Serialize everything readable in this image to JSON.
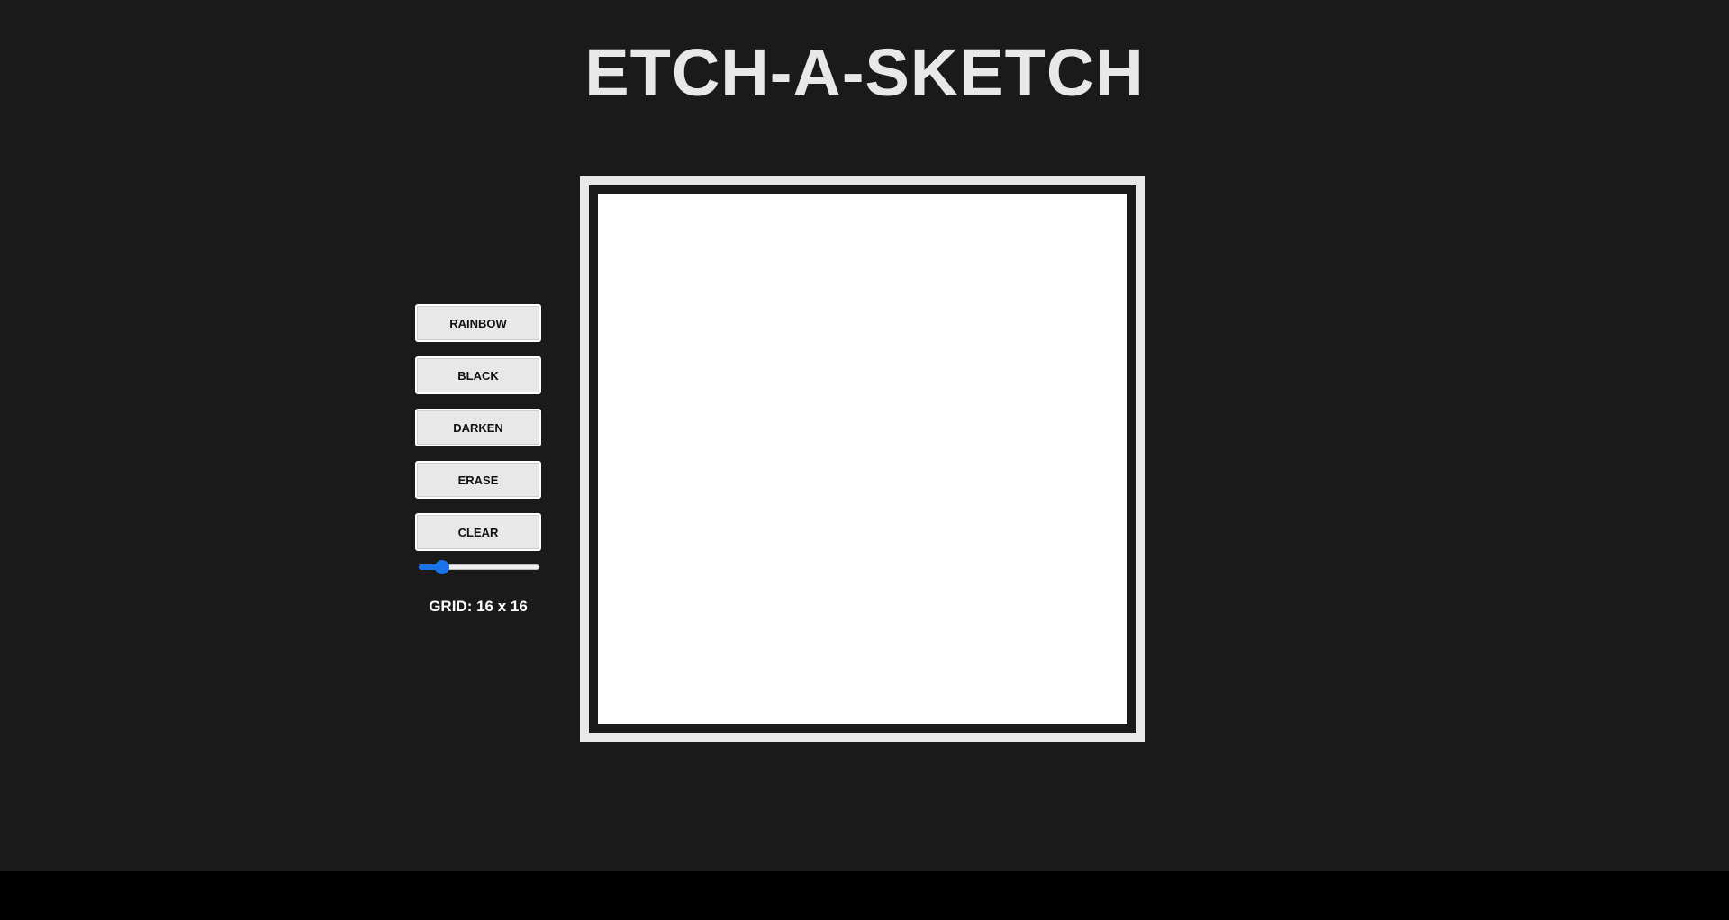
{
  "header": {
    "title": "ETCH-A-SKETCH"
  },
  "controls": {
    "buttons": [
      {
        "name": "rainbow-button",
        "label": "RAINBOW"
      },
      {
        "name": "black-button",
        "label": "BLACK"
      },
      {
        "name": "darken-button",
        "label": "DARKEN"
      },
      {
        "name": "erase-button",
        "label": "ERASE"
      },
      {
        "name": "clear-button",
        "label": "CLEAR"
      }
    ],
    "slider": {
      "value": 16,
      "min": 1,
      "max": 100
    },
    "grid_label": "GRID: 16 x 16"
  },
  "sketch": {
    "grid_size": 16,
    "cell_color": "#ffffff"
  },
  "colors": {
    "background": "#1a1a1a",
    "button_bg": "#e8e8e8",
    "accent": "#1a73e8",
    "title": "#e8e8e8"
  }
}
